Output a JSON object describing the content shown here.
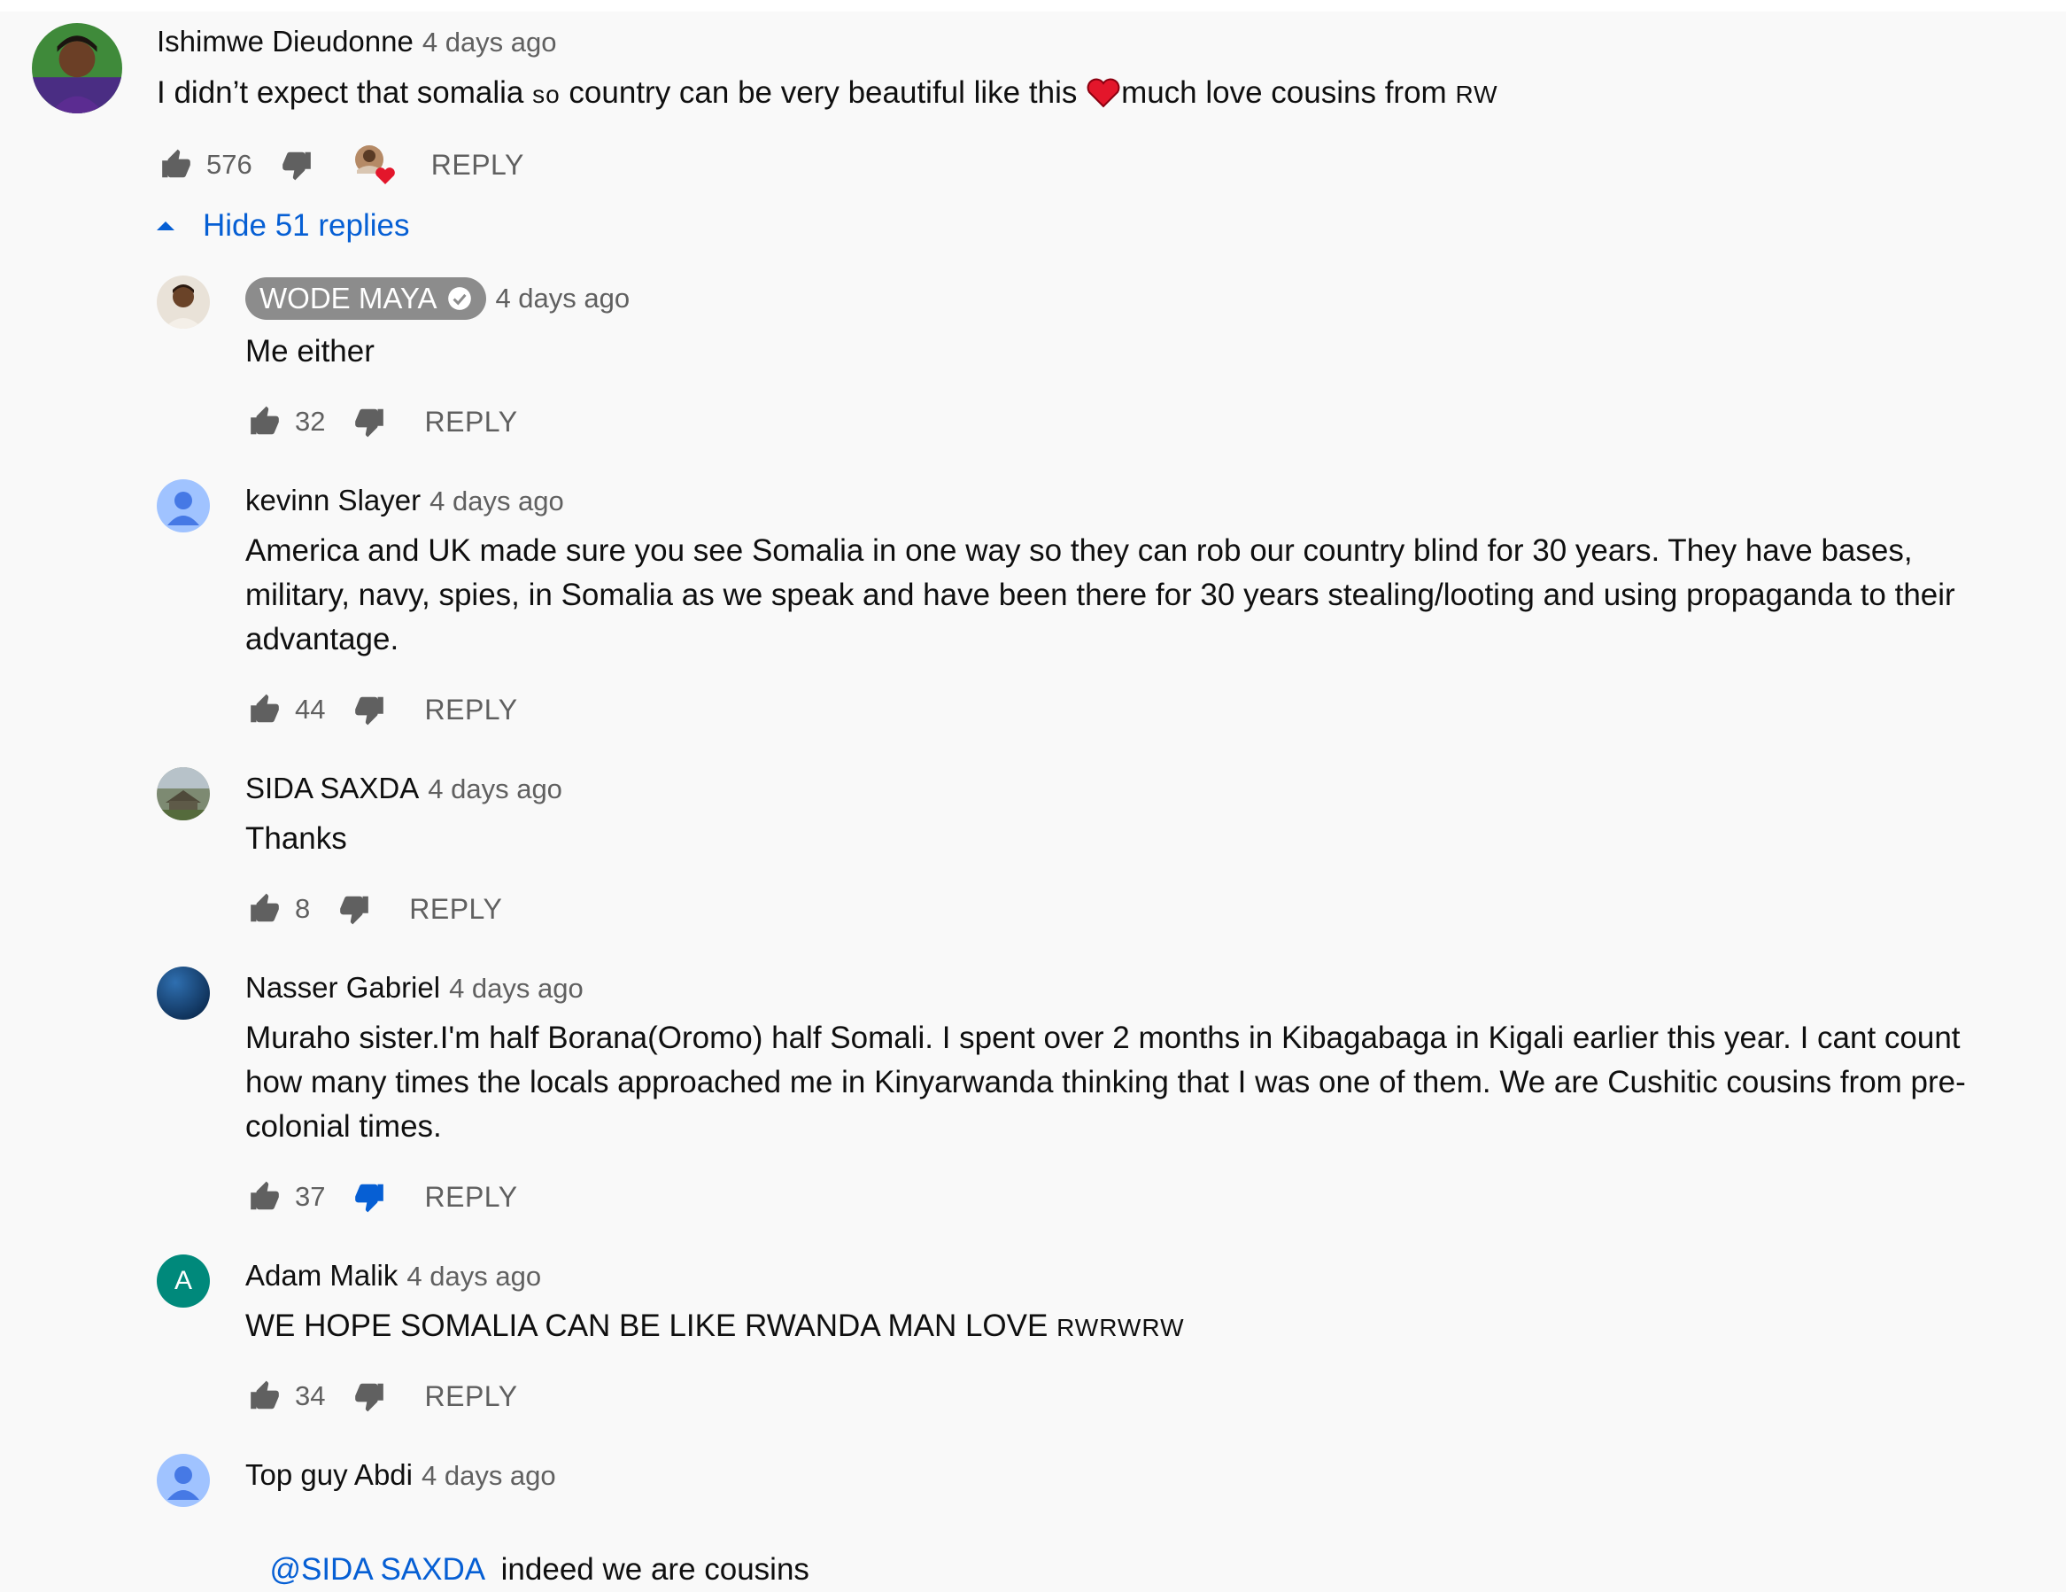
{
  "comments": [
    {
      "author": "Ishimwe Dieudonne",
      "time": "4 days ago",
      "text_before": "I didn’t expect that somalia ",
      "text_small": "so",
      "text_after": " country can be very beautiful like this ",
      "text_after_heart": "much love cousins from ",
      "text_tail_small": "RW",
      "likes": "576",
      "reply_label": "REPLY"
    }
  ],
  "replies_toggle": "Hide 51 replies",
  "replies": [
    {
      "author": "WODE MAYA",
      "time": "4 days ago",
      "text": "Me either",
      "likes": "32",
      "reply_label": "REPLY"
    },
    {
      "author": "kevinn Slayer",
      "time": "4 days ago",
      "text": "America and UK made sure you see Somalia in one way so they can rob our country blind for 30 years.  They have bases, military, navy, spies, in Somalia as we speak and have been there for 30 years stealing/looting and using propaganda to their advantage.",
      "likes": "44",
      "reply_label": "REPLY"
    },
    {
      "author": "SIDA SAXDA",
      "time": "4 days ago",
      "text": "Thanks",
      "likes": "8",
      "reply_label": "REPLY"
    },
    {
      "author": "Nasser Gabriel",
      "time": "4 days ago",
      "text": "Muraho sister.I'm half Borana(Oromo) half Somali. I spent over 2 months in Kibagabaga in Kigali earlier this year. I cant count how many times the locals approached me in Kinyarwanda thinking that I was one of them. We are Cushitic cousins from pre-colonial times.",
      "likes": "37",
      "reply_label": "REPLY"
    },
    {
      "author": "Adam Malik",
      "time": "4 days ago",
      "text": "WE HOPE SOMALIA CAN BE LIKE RWANDA MAN LOVE ",
      "text_small": "RWRWRW",
      "likes": "34",
      "reply_label": "REPLY",
      "avatar_letter": "A"
    },
    {
      "author": "Top guy Abdi",
      "time": "4 days ago",
      "mention": "@SIDA SAXDA",
      "text": "  indeed we are cousins"
    }
  ],
  "colors": {
    "link": "#065fd4",
    "secondary_text": "#606060",
    "badge_bg": "#8c8c8c",
    "disliked": "#065fd4",
    "heart": "#e3162b",
    "adam_avatar": "#00897b",
    "default_avatar": "#a0c3ff"
  }
}
